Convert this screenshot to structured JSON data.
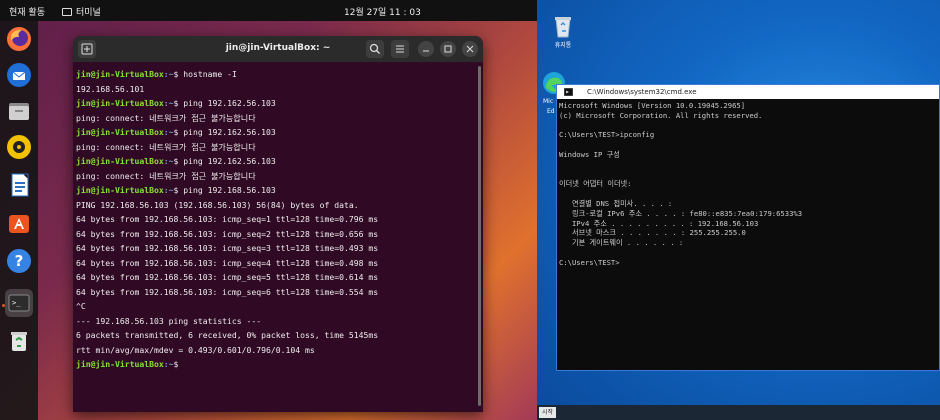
{
  "ubuntu": {
    "topbar": {
      "activities": "현재 활동",
      "app_menu": "터미널",
      "clock": "12월 27일  11 : 03"
    },
    "dock": [
      "firefox-icon",
      "thunderbird-icon",
      "files-icon",
      "rhythmbox-icon",
      "writer-icon",
      "app-center-icon",
      "help-icon",
      "terminal-icon",
      "trash-icon"
    ]
  },
  "terminal": {
    "title": "jin@jin-VirtualBox: ~",
    "lines": [
      {
        "user": "jin@jin-VirtualBox",
        "path": ":~",
        "cmd": "$ hostname -I"
      },
      {
        "text": "192.168.56.101"
      },
      {
        "user": "jin@jin-VirtualBox",
        "path": ":~",
        "cmd": "$ ping 192.162.56.103"
      },
      {
        "text": "ping: connect: 네트워크가 접근 불가능합니다"
      },
      {
        "user": "jin@jin-VirtualBox",
        "path": ":~",
        "cmd": "$ ping 192.162.56.103"
      },
      {
        "text": "ping: connect: 네트워크가 접근 불가능합니다"
      },
      {
        "user": "jin@jin-VirtualBox",
        "path": ":~",
        "cmd": "$ ping 192.162.56.103"
      },
      {
        "text": "ping: connect: 네트워크가 접근 불가능합니다"
      },
      {
        "user": "jin@jin-VirtualBox",
        "path": ":~",
        "cmd": "$ ping 192.168.56.103"
      },
      {
        "text": "PING 192.168.56.103 (192.168.56.103) 56(84) bytes of data."
      },
      {
        "text": "64 bytes from 192.168.56.103: icmp_seq=1 ttl=128 time=0.796 ms"
      },
      {
        "text": "64 bytes from 192.168.56.103: icmp_seq=2 ttl=128 time=0.656 ms"
      },
      {
        "text": "64 bytes from 192.168.56.103: icmp_seq=3 ttl=128 time=0.493 ms"
      },
      {
        "text": "64 bytes from 192.168.56.103: icmp_seq=4 ttl=128 time=0.498 ms"
      },
      {
        "text": "64 bytes from 192.168.56.103: icmp_seq=5 ttl=128 time=0.614 ms"
      },
      {
        "text": "64 bytes from 192.168.56.103: icmp_seq=6 ttl=128 time=0.554 ms"
      },
      {
        "text": "^C"
      },
      {
        "text": "--- 192.168.56.103 ping statistics ---"
      },
      {
        "text": "6 packets transmitted, 6 received, 0% packet loss, time 5145ms"
      },
      {
        "text": "rtt min/avg/max/mdev = 0.493/0.601/0.796/0.104 ms"
      },
      {
        "user": "jin@jin-VirtualBox",
        "path": ":~",
        "cmd": "$ "
      }
    ]
  },
  "windows": {
    "recycle_label": "휴지통",
    "edge_label": "Mic",
    "edge_label2": "Ed",
    "cmd_title": "C:\\Windows\\system32\\cmd.exe",
    "cmd_lines": [
      "Microsoft Windows [Version 10.0.19045.2965]",
      "(c) Microsoft Corporation. All rights reserved.",
      "",
      "C:\\Users\\TEST>ipconfig",
      "",
      "Windows IP 구성",
      "",
      "",
      "이더넷 어댑터 이더넷:",
      "",
      "   연결별 DNS 접미사. . . . :",
      "   링크-로컬 IPv6 주소 . . . . : fe80::e835:7ea0:179:6533%3",
      "   IPv4 주소 . . . . . . . . . : 192.168.56.103",
      "   서브넷 마스크 . . . . . . . : 255.255.255.0",
      "   기본 게이트웨이 . . . . . . :",
      "",
      "C:\\Users\\TEST>"
    ],
    "start_label": "시작"
  }
}
